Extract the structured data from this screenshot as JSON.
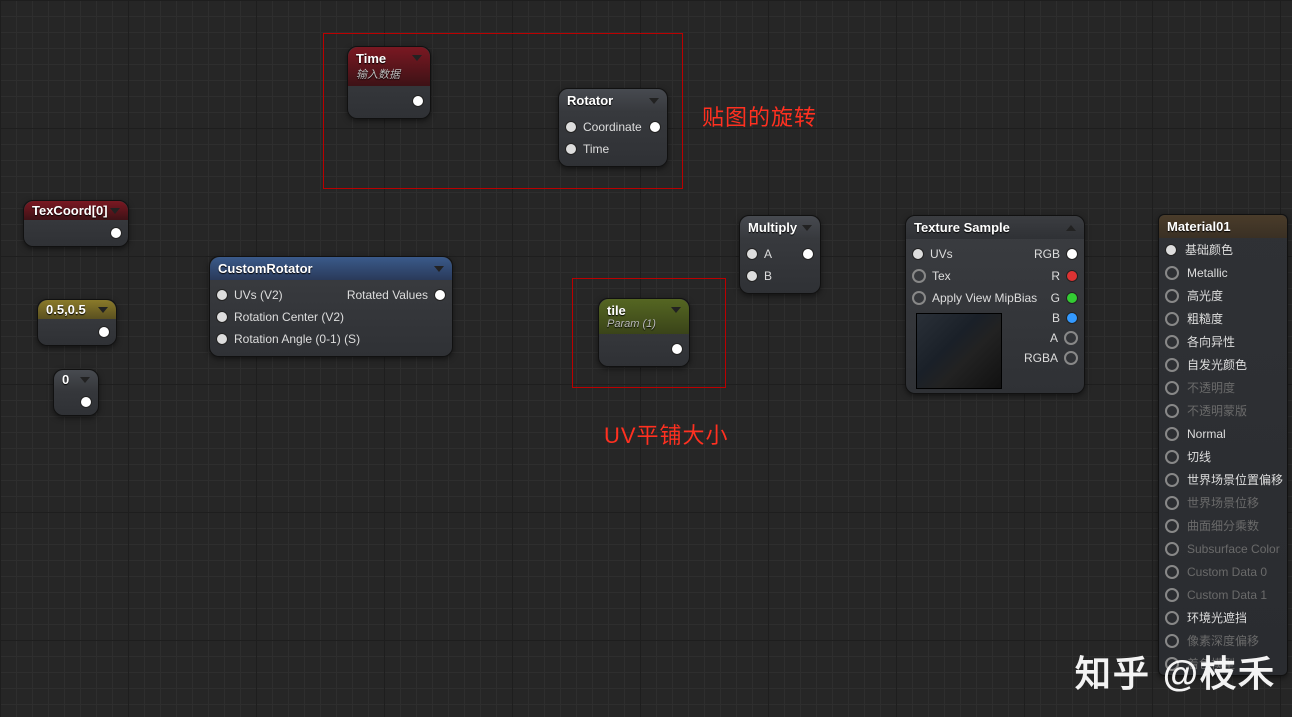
{
  "annotations": {
    "rotation_label": "贴图的旋转",
    "uv_tile_label": "UV平铺大小"
  },
  "watermark": "知乎 @枝禾",
  "nodes": {
    "texcoord": {
      "title": "TexCoord[0]"
    },
    "const2": {
      "title": "0.5,0.5"
    },
    "const1": {
      "title": "0"
    },
    "time": {
      "title": "Time",
      "subtitle": "输入数据"
    },
    "rotator": {
      "title": "Rotator",
      "in1": "Coordinate",
      "in2": "Time"
    },
    "custom_rotator": {
      "title": "CustomRotator",
      "in1": "UVs (V2)",
      "in2": "Rotation Center (V2)",
      "in3": "Rotation Angle (0-1) (S)",
      "out": "Rotated Values"
    },
    "tile": {
      "title": "tile",
      "subtitle": "Param (1)"
    },
    "multiply": {
      "title": "Multiply",
      "in1": "A",
      "in2": "B"
    },
    "texture_sample": {
      "title": "Texture Sample",
      "in1": "UVs",
      "in2": "Tex",
      "in3": "Apply View MipBias",
      "out1": "RGB",
      "out2": "R",
      "out3": "G",
      "out4": "B",
      "out5": "A",
      "out6": "RGBA"
    },
    "material": {
      "title": "Material01",
      "pins": [
        {
          "label": "基础颜色",
          "enabled": true,
          "connected": true
        },
        {
          "label": "Metallic",
          "enabled": true,
          "connected": false
        },
        {
          "label": "高光度",
          "enabled": true,
          "connected": false
        },
        {
          "label": "粗糙度",
          "enabled": true,
          "connected": false
        },
        {
          "label": "各向异性",
          "enabled": true,
          "connected": false
        },
        {
          "label": "自发光颜色",
          "enabled": true,
          "connected": false
        },
        {
          "label": "不透明度",
          "enabled": false,
          "connected": false
        },
        {
          "label": "不透明蒙版",
          "enabled": false,
          "connected": false
        },
        {
          "label": "Normal",
          "enabled": true,
          "connected": false
        },
        {
          "label": "切线",
          "enabled": true,
          "connected": false
        },
        {
          "label": "世界场景位置偏移",
          "enabled": true,
          "connected": false
        },
        {
          "label": "世界场景位移",
          "enabled": false,
          "connected": false
        },
        {
          "label": "曲面细分乘数",
          "enabled": false,
          "connected": false
        },
        {
          "label": "Subsurface Color",
          "enabled": false,
          "connected": false
        },
        {
          "label": "Custom Data 0",
          "enabled": false,
          "connected": false
        },
        {
          "label": "Custom Data 1",
          "enabled": false,
          "connected": false
        },
        {
          "label": "环境光遮挡",
          "enabled": true,
          "connected": false
        },
        {
          "label": "像素深度偏移",
          "enabled": false,
          "connected": false
        },
        {
          "label": "着色模型",
          "enabled": false,
          "connected": false
        }
      ]
    }
  }
}
